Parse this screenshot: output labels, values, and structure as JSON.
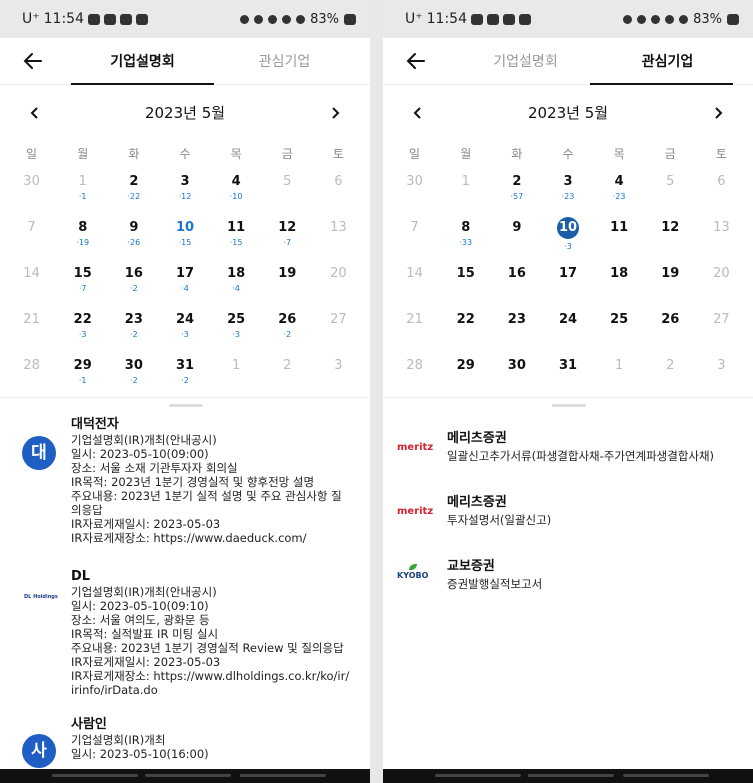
{
  "status": {
    "time": "11:54",
    "carrier": "U⁺",
    "battery": "83%"
  },
  "phone1": {
    "tabs": [
      "기업설명회",
      "관심기업"
    ],
    "month": "2023년 5월",
    "weekdays": [
      "일",
      "월",
      "화",
      "수",
      "목",
      "금",
      "토"
    ],
    "days": [
      {
        "n": "30",
        "o": true
      },
      {
        "n": "1",
        "o": true,
        "c": "·1"
      },
      {
        "n": "2",
        "c": "·22"
      },
      {
        "n": "3",
        "c": "·12"
      },
      {
        "n": "4",
        "c": "·10"
      },
      {
        "n": "5",
        "o": true
      },
      {
        "n": "6",
        "o": true
      },
      {
        "n": "7",
        "o": true
      },
      {
        "n": "8",
        "c": "·19"
      },
      {
        "n": "9",
        "c": "·26"
      },
      {
        "n": "10",
        "c": "·15",
        "today": true
      },
      {
        "n": "11",
        "c": "·15"
      },
      {
        "n": "12",
        "c": "·7"
      },
      {
        "n": "13",
        "o": true
      },
      {
        "n": "14",
        "o": true
      },
      {
        "n": "15",
        "c": "·7"
      },
      {
        "n": "16",
        "c": "·2"
      },
      {
        "n": "17",
        "c": "·4"
      },
      {
        "n": "18",
        "c": "·4"
      },
      {
        "n": "19"
      },
      {
        "n": "20",
        "o": true
      },
      {
        "n": "21",
        "o": true
      },
      {
        "n": "22",
        "c": "·3"
      },
      {
        "n": "23",
        "c": "·2"
      },
      {
        "n": "24",
        "c": "·3"
      },
      {
        "n": "25",
        "c": "·3"
      },
      {
        "n": "26",
        "c": "·2"
      },
      {
        "n": "27",
        "o": true
      },
      {
        "n": "28",
        "o": true
      },
      {
        "n": "29",
        "c": "·1"
      },
      {
        "n": "30",
        "c": "·2"
      },
      {
        "n": "31",
        "c": "·2"
      },
      {
        "n": "1",
        "o": true
      },
      {
        "n": "2",
        "o": true
      },
      {
        "n": "3",
        "o": true
      }
    ],
    "events": [
      {
        "avatar": "대",
        "name": "대덕전자",
        "lines": [
          "기업설명회(IR)개최(안내공시)",
          "일시: 2023-05-10(09:00)",
          "장소: 서울 소재 기관투자자 회의실",
          "IR목적: 2023년 1분기 경영실적 및 향후전망 설명",
          "주요내용: 2023년 1분기 실적 설명 및 주요 관심사항 질",
          "의응답",
          "IR자료게재일시: 2023-05-03",
          "IR자료게재장소: https://www.daeduck.com/"
        ]
      },
      {
        "avatar": "DL Holdings",
        "name": "DL",
        "lines": [
          "기업설명회(IR)개최(안내공시)",
          "일시: 2023-05-10(09:10)",
          "장소: 서울 여의도, 광화문 등",
          "IR목적: 실적발표 IR 미팅 실시",
          "주요내용: 2023년 1분기 경영실적 Review 및 질의응답",
          "IR자료게재일시: 2023-05-03",
          "IR자료게재장소: https://www.dlholdings.co.kr/ko/ir/",
          "irinfo/irData.do"
        ]
      },
      {
        "avatar": "사",
        "name": "사람인",
        "lines": [
          "기업설명회(IR)개최",
          "일시: 2023-05-10(16:00)"
        ]
      }
    ]
  },
  "phone2": {
    "tabs": [
      "기업설명회",
      "관심기업"
    ],
    "month": "2023년 5월",
    "weekdays": [
      "일",
      "월",
      "화",
      "수",
      "목",
      "금",
      "토"
    ],
    "days": [
      {
        "n": "30",
        "o": true
      },
      {
        "n": "1",
        "o": true
      },
      {
        "n": "2",
        "c": "·57"
      },
      {
        "n": "3",
        "c": "·23"
      },
      {
        "n": "4",
        "c": "·23"
      },
      {
        "n": "5",
        "o": true
      },
      {
        "n": "6",
        "o": true
      },
      {
        "n": "7",
        "o": true
      },
      {
        "n": "8",
        "c": "·33"
      },
      {
        "n": "9"
      },
      {
        "n": "10",
        "c": "·3",
        "sel": true
      },
      {
        "n": "11"
      },
      {
        "n": "12"
      },
      {
        "n": "13",
        "o": true
      },
      {
        "n": "14",
        "o": true
      },
      {
        "n": "15"
      },
      {
        "n": "16"
      },
      {
        "n": "17"
      },
      {
        "n": "18"
      },
      {
        "n": "19"
      },
      {
        "n": "20",
        "o": true
      },
      {
        "n": "21",
        "o": true
      },
      {
        "n": "22"
      },
      {
        "n": "23"
      },
      {
        "n": "24"
      },
      {
        "n": "25"
      },
      {
        "n": "26"
      },
      {
        "n": "27",
        "o": true
      },
      {
        "n": "28",
        "o": true
      },
      {
        "n": "29"
      },
      {
        "n": "30"
      },
      {
        "n": "31"
      },
      {
        "n": "1",
        "o": true
      },
      {
        "n": "2",
        "o": true
      },
      {
        "n": "3",
        "o": true
      }
    ],
    "items": [
      {
        "logo": "meritz",
        "name": "메리츠증권",
        "desc": "일괄신고추가서류(파생결합사채-주가연계파생결합사채)"
      },
      {
        "logo": "meritz",
        "name": "메리츠증권",
        "desc": "투자설명서(일괄신고)"
      },
      {
        "logo": "KYOBO",
        "name": "교보증권",
        "desc": "증권발행실적보고서"
      }
    ]
  }
}
